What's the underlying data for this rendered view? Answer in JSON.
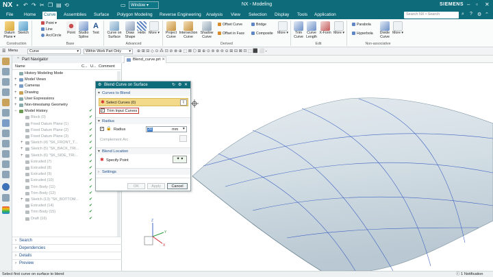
{
  "app": {
    "logo": "NX",
    "title": "NX - Modeling",
    "window_menu": "Window",
    "brand": "SIEMENS",
    "search_placeholder": "Search NX • Search"
  },
  "menu": [
    "File",
    "Home",
    "Curve",
    "Assemblies",
    "Surface",
    "Polygon Modeling",
    "Reverse Engineering",
    "Analysis",
    "View",
    "Selection",
    "Display",
    "Tools",
    "Application"
  ],
  "menu_active": "Curve",
  "ribbon": {
    "construction": {
      "label": "Construction",
      "datum_plane": "Datum Plane",
      "sketch": "Sketch"
    },
    "base": {
      "label": "Base",
      "point": "Point",
      "line": "Line",
      "arc_circle": "Arc/Circle",
      "point_big": "Point",
      "studio_spline": "Studio Spline",
      "text": "Text"
    },
    "advanced": {
      "label": "Advanced",
      "curve_on_surface": "Curve on Surface",
      "draw_shape": "Draw Shape",
      "helix": "Helix",
      "more": "More"
    },
    "derived": {
      "label": "Derived",
      "project_curve": "Project Curve",
      "intersection_curve": "Intersection Curve",
      "shadow_curve": "Shadow Curve",
      "offset_curve": "Offset Curve",
      "offset_in_face": "Offset in Face",
      "bridge": "Bridge",
      "composite": "Composite",
      "more": "More"
    },
    "edit": {
      "label": "Edit",
      "trim_curve": "Trim Curve",
      "curve_length": "Curve Length",
      "x_form": "X-Form",
      "more": "More"
    },
    "nonassoc": {
      "label": "Non-associative",
      "parabola": "Parabola",
      "hyperbola": "Hyperbola",
      "divide_curve": "Divide Curve",
      "more": "More"
    }
  },
  "selection": {
    "menu": "Menu",
    "filter": "Curve",
    "scope": "Within Work Part Only"
  },
  "navigator": {
    "title": "Part Navigator",
    "columns": {
      "name": "Name",
      "c": "C...",
      "u": "U...",
      "comment": "Comment"
    },
    "rows": [
      {
        "label": "History Modeling Mode",
        "indent": 0,
        "expand": "",
        "check": false,
        "grey": false,
        "icon": "#8aa"
      },
      {
        "label": "Model Views",
        "indent": 0,
        "expand": "+",
        "check": false,
        "grey": false,
        "icon": "#7a9cc6"
      },
      {
        "label": "Cameras",
        "indent": 0,
        "expand": "+",
        "check": false,
        "grey": false,
        "icon": "#7a9cc6"
      },
      {
        "label": "Drawing",
        "indent": 0,
        "expand": "+",
        "check": false,
        "grey": false,
        "icon": "#c9a25c"
      },
      {
        "label": "User Expressions",
        "indent": 0,
        "expand": "+",
        "check": false,
        "grey": false,
        "icon": "#8aa"
      },
      {
        "label": "Non-timestamp Geometry",
        "indent": 0,
        "expand": "+",
        "check": false,
        "grey": false,
        "icon": "#8aa"
      },
      {
        "label": "Model History",
        "indent": 0,
        "expand": "−",
        "check": true,
        "grey": false,
        "icon": "#6a9a52"
      },
      {
        "label": "Block (0)",
        "indent": 1,
        "expand": "",
        "check": true,
        "grey": true,
        "icon": "#b7bcbf"
      },
      {
        "label": "Fixed Datum Plane (1)",
        "indent": 1,
        "expand": "",
        "check": true,
        "grey": true,
        "icon": "#b7bcbf"
      },
      {
        "label": "Fixed Datum Plane (2)",
        "indent": 1,
        "expand": "",
        "check": true,
        "grey": true,
        "icon": "#b7bcbf"
      },
      {
        "label": "Fixed Datum Plane (3)",
        "indent": 1,
        "expand": "",
        "check": true,
        "grey": true,
        "icon": "#b7bcbf"
      },
      {
        "label": "Sketch (4) \"SK_FRONT_T...",
        "indent": 1,
        "expand": "+",
        "check": true,
        "grey": true,
        "icon": "#b7bcbf"
      },
      {
        "label": "Sketch (5) \"SK_BACK_TRI...",
        "indent": 1,
        "expand": "+",
        "check": true,
        "grey": true,
        "icon": "#b7bcbf"
      },
      {
        "label": "Sketch (6) \"SK_SIDE_TRI...",
        "indent": 1,
        "expand": "+",
        "check": true,
        "grey": true,
        "icon": "#b7bcbf"
      },
      {
        "label": "Extruded (7)",
        "indent": 1,
        "expand": "",
        "check": true,
        "grey": true,
        "icon": "#b7bcbf"
      },
      {
        "label": "Extruded (8)",
        "indent": 1,
        "expand": "",
        "check": true,
        "grey": true,
        "icon": "#b7bcbf"
      },
      {
        "label": "Extruded (9)",
        "indent": 1,
        "expand": "",
        "check": true,
        "grey": true,
        "icon": "#b7bcbf"
      },
      {
        "label": "Extruded (10)",
        "indent": 1,
        "expand": "",
        "check": true,
        "grey": true,
        "icon": "#b7bcbf"
      },
      {
        "label": "Trim Body (11)",
        "indent": 1,
        "expand": "",
        "check": true,
        "grey": true,
        "icon": "#b7bcbf"
      },
      {
        "label": "Trim Body (12)",
        "indent": 1,
        "expand": "",
        "check": true,
        "grey": true,
        "icon": "#b7bcbf"
      },
      {
        "label": "Sketch (13) \"SK_BOTTOM...",
        "indent": 1,
        "expand": "+",
        "check": true,
        "grey": true,
        "icon": "#b7bcbf"
      },
      {
        "label": "Extruded (14)",
        "indent": 1,
        "expand": "",
        "check": true,
        "grey": true,
        "icon": "#b7bcbf"
      },
      {
        "label": "Trim Body (15)",
        "indent": 1,
        "expand": "",
        "check": true,
        "grey": true,
        "icon": "#b7bcbf"
      },
      {
        "label": "Draft (16)",
        "indent": 1,
        "expand": "",
        "check": true,
        "grey": true,
        "icon": "#b7bcbf"
      }
    ],
    "sections": [
      "Search",
      "Dependencies",
      "Details",
      "Preview"
    ]
  },
  "viewport": {
    "tab": "Blend_curve.prt"
  },
  "dialog": {
    "title": "Blend Curve on Surface",
    "curves_section": "Curves to Blend",
    "select_curves": "Select Curves (0)",
    "trim_input": "Trim Input Curves",
    "radius_section": "Radius",
    "radius_label": "Radius",
    "radius_value": "20",
    "radius_unit": "mm",
    "complement_arc": "Complement Arc",
    "blend_location_section": "Blend Location",
    "specify_point": "Specify Point",
    "settings_section": "Settings",
    "ok": "OK",
    "apply": "Apply",
    "cancel": "Cancel"
  },
  "status": {
    "prompt": "Select first curve on surface to blend",
    "notification": "1 Notification"
  },
  "colors": {
    "brand": "#0d6b7a",
    "highlight": "#f3d98a",
    "required": "#d2262a",
    "surface": "#d7e2e8",
    "wire": "#3f63c2"
  }
}
